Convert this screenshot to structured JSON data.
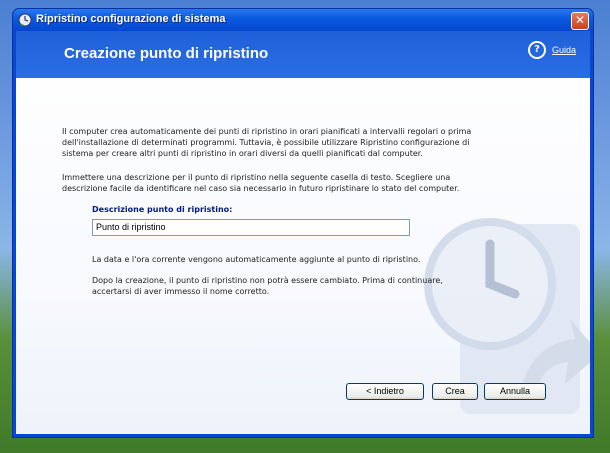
{
  "window": {
    "title": "Ripristino configurazione di sistema",
    "close_symbol": "✕"
  },
  "header": {
    "title": "Creazione punto di ripristino",
    "help_label": "Guida",
    "help_symbol": "?"
  },
  "content": {
    "intro": "Il computer crea automaticamente dei punti di ripristino in orari pianificati a intervalli regolari o prima dell'installazione di determinati programmi. Tuttavia, è possibile utilizzare Ripristino configurazione di sistema per creare altri punti di ripristino in orari diversi da quelli pianificati dal computer.",
    "instructions": "Immettere una descrizione per il punto di ripristino nella seguente casella di testo. Scegliere una descrizione facile da identificare nel caso sia necessario in futuro ripristinare lo stato del computer.",
    "field_label": "Descrizione punto di ripristino:",
    "field_value": "Punto di ripristino",
    "note_date": "La data e l'ora corrente vengono automaticamente aggiunte al punto di ripristino.",
    "note_warning": "Dopo la creazione, il punto di ripristino non potrà essere cambiato. Prima di continuare, accertarsi di aver immesso il nome corretto."
  },
  "buttons": {
    "back": "< Indietro",
    "create": "Crea",
    "cancel": "Annulla"
  },
  "colors": {
    "title_bar": "#0546cf",
    "header": "#1e60d8",
    "field_label": "#001a80"
  }
}
